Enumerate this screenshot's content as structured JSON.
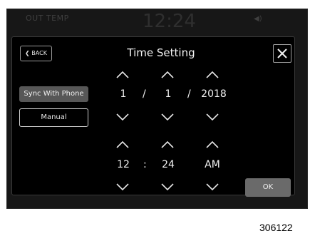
{
  "status_bar": {
    "temp_label": "OUT TEMP",
    "clock": "12:24"
  },
  "dialog": {
    "back_label": "BACK",
    "title": "Time Setting",
    "sync_label": "Sync With Phone",
    "manual_label": "Manual",
    "date": {
      "month": "1",
      "day": "1",
      "year": "2018",
      "separator": "/"
    },
    "time": {
      "hour": "12",
      "minute": "24",
      "period": "AM",
      "separator": ":"
    },
    "ok_label": "OK"
  },
  "figure_id": "306122"
}
